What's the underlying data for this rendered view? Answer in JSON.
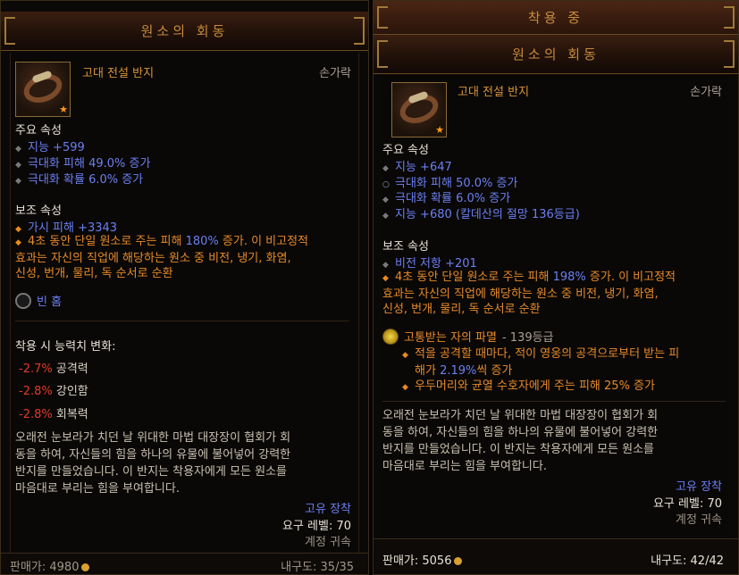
{
  "left": {
    "title": "원소의 회동",
    "item_type": "고대 전설 반지",
    "slot": "손가락",
    "primary_title": "주요 속성",
    "primary": [
      "지능 +599",
      "극대화 피해 49.0% 증가",
      "극대화 확률 6.0% 증가"
    ],
    "secondary_title": "보조 속성",
    "secondary_1": "가시 피해 +3343",
    "legend_pre": "4초 동안 단일 원소로 주는 피해 ",
    "legend_pct": "180%",
    "legend_post": " 증가. 이 비고정적",
    "legend_line2": "효과는 자신의 직업에 해당하는 원소 중 비전, 냉기, 화염,",
    "legend_line3": "신성, 번개, 물리, 독 순서로 순환",
    "socket": "빈 홈",
    "change_title": "착용 시 능력치 변화:",
    "changes": [
      {
        "value": "-2.7%",
        "label": "공격력"
      },
      {
        "value": "-2.8%",
        "label": "강인함"
      },
      {
        "value": "-2.8%",
        "label": "회복력"
      }
    ],
    "flavor": [
      "오래전 눈보라가 치던 날 위대한 마법 대장장이 협회가 회",
      "동을 하여, 자신들의 힘을 하나의 유물에 불어넣어 강력한",
      "반지를 만들었습니다. 이 반지는 착용자에게 모든 원소를",
      "마음대로 부리는 힘을 부여합니다."
    ],
    "rarity": "고유 장착",
    "required_level": "요구 레벨: 70",
    "account_bound": "계정 귀속",
    "price": "판매가: 4980",
    "durability": "내구도: 35/35"
  },
  "right": {
    "equipped_label": "착용 중",
    "title": "원소의 회동",
    "item_type": "고대 전설 반지",
    "slot": "손가락",
    "primary_title": "주요 속성",
    "primary": [
      "지능 +647",
      "극대화 피해 50.0% 증가",
      "극대화 확률 6.0% 증가",
      "지능 +680 (칼데산의 절망 136등급)"
    ],
    "secondary_title": "보조 속성",
    "secondary_1": "비전 저항 +201",
    "legend_pre": "4초 동안 단일 원소로 주는 피해 ",
    "legend_pct": "198%",
    "legend_post": " 증가. 이 비고정적",
    "legend_line2": "효과는 자신의 직업에 해당하는 원소 중 비전, 냉기, 화염,",
    "legend_line3": "신성, 번개, 물리, 독 순서로 순환",
    "gem_name": "고통받는 자의 파멸",
    "gem_rank": " - 139등급",
    "gem_effect1_a": "적을 공격할 때마다, 적이 영웅의 공격으로부터 받는 피",
    "gem_effect1_b_pre": "해가 ",
    "gem_effect1_b_pct": "2.19%",
    "gem_effect1_b_post": "씩 증가",
    "gem_effect2": "우두머리와 균열 수호자에게 주는 피해 25% 증가",
    "flavor": [
      "오래전 눈보라가 치던 날 위대한 마법 대장장이 협회가 회",
      "동을 하여, 자신들의 힘을 하나의 유물에 불어넣어 강력한",
      "반지를 만들었습니다. 이 반지는 착용자에게 모든 원소를",
      "마음대로 부리는 힘을 부여합니다."
    ],
    "rarity": "고유 장착",
    "required_level": "요구 레벨: 70",
    "account_bound": "계정 귀속",
    "price": "판매가: 5056",
    "durability": "내구도: 42/42"
  }
}
